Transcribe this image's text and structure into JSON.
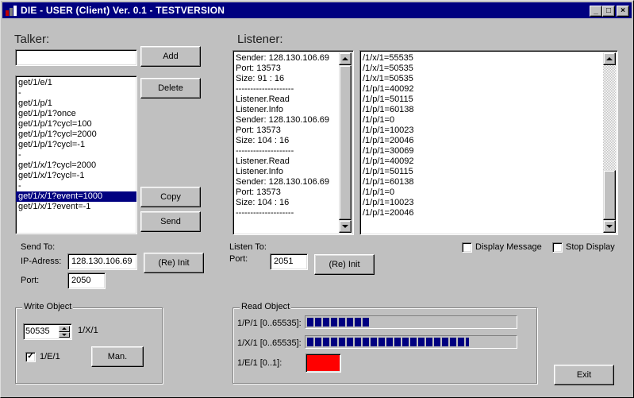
{
  "window": {
    "title": "DIE - USER (Client) Ver. 0.1 - TESTVERSION",
    "controls": {
      "minimize": "_",
      "maximize": "□",
      "close": "×"
    }
  },
  "talker": {
    "heading": "Talker:",
    "input_value": "",
    "add_label": "Add",
    "delete_label": "Delete",
    "copy_label": "Copy",
    "send_label": "Send",
    "items": [
      "get/1/e/1",
      "-",
      "get/1/p/1",
      "get/1/p/1?once",
      "get/1/p/1?cycl=100",
      "get/1/p/1?cycl=2000",
      "get/1/p/1?cycl=-1",
      "-",
      "get/1/x/1?cycl=2000",
      "get/1/x/1?cycl=-1",
      "-",
      "get/1/x/1?event=1000",
      "get/1/x/1?event=-1"
    ],
    "selected_index": 11
  },
  "send_to": {
    "heading": "Send To:",
    "ip_label": "IP-Adress:",
    "ip_value": "128.130.106.69",
    "port_label": "Port:",
    "port_value": "2050",
    "reinit_label": "(Re) Init"
  },
  "write_object": {
    "legend": "Write Object",
    "spin_value": "50535",
    "spin_label": "1/X/1",
    "check_label": "1/E/1",
    "check_checked": true,
    "man_label": "Man."
  },
  "listener": {
    "heading": "Listener:",
    "log": [
      "Sender: 128.130.106.69",
      "Port: 13573",
      "Size: 91 : 16",
      "--------------------",
      "Listener.Read",
      "Listener.Info",
      "Sender: 128.130.106.69",
      "Port: 13573",
      "Size: 104 : 16",
      "--------------------",
      "Listener.Read",
      "Listener.Info",
      "Sender: 128.130.106.69",
      "Port: 13573",
      "Size: 104 : 16",
      "--------------------"
    ],
    "values": [
      "/1/x/1=55535",
      "/1/x/1=50535",
      "/1/x/1=50535",
      "/1/p/1=40092",
      "/1/p/1=50115",
      "/1/p/1=60138",
      "/1/p/1=0",
      "/1/p/1=10023",
      "/1/p/1=20046",
      "/1/p/1=30069",
      "/1/p/1=40092",
      "/1/p/1=50115",
      "/1/p/1=60138",
      "/1/p/1=0",
      "/1/p/1=10023",
      "/1/p/1=20046"
    ],
    "display_message_label": "Display Message",
    "display_message_checked": false,
    "stop_display_label": "Stop Display",
    "stop_display_checked": false
  },
  "listen_to": {
    "heading": "Listen To:",
    "port_label": "Port:",
    "port_value": "2051",
    "reinit_label": "(Re) Init"
  },
  "read_object": {
    "legend": "Read Object",
    "p_label": "1/P/1 [0..65535]:",
    "p_level": 0.3,
    "x_label": "1/X/1 [0..65535]:",
    "x_level": 0.78,
    "e_label": "1/E/1 [0..1]:",
    "e_color": "#ff0000"
  },
  "exit_label": "Exit",
  "colors": {
    "face": "#c0c0c0",
    "title": "#000080",
    "selection": "#000080",
    "progress": "#000080"
  }
}
